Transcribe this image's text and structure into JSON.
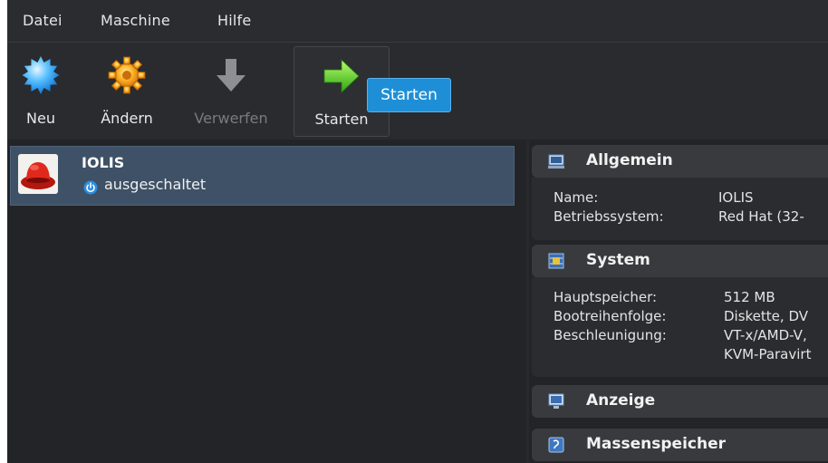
{
  "menu": [
    "Datei",
    "Maschine",
    "Hilfe"
  ],
  "toolbar": {
    "new": "Neu",
    "change": "Ändern",
    "discard": "Verwerfen",
    "start": "Starten",
    "tooltip": "Starten"
  },
  "vm": {
    "name": "IOLIS",
    "state": "ausgeschaltet"
  },
  "details": {
    "general": {
      "title": "Allgemein",
      "name_label": "Name:",
      "name_value": "IOLIS",
      "os_label": "Betriebssystem:",
      "os_value": "Red Hat (32-"
    },
    "system": {
      "title": "System",
      "ram_label": "Hauptspeicher:",
      "ram_value": "512 MB",
      "boot_label": "Bootreihenfolge:",
      "boot_value": "Diskette, DV",
      "accel_label": "Beschleunigung:",
      "accel_value_1": "VT-x/AMD-V, ",
      "accel_value_2": "KVM-Paravirt"
    },
    "display": {
      "title": "Anzeige"
    },
    "storage": {
      "title": "Massenspeicher"
    }
  },
  "colors": {
    "selection": "#3e5166",
    "tooltip": "#1e8fd6",
    "background": "#232427"
  }
}
